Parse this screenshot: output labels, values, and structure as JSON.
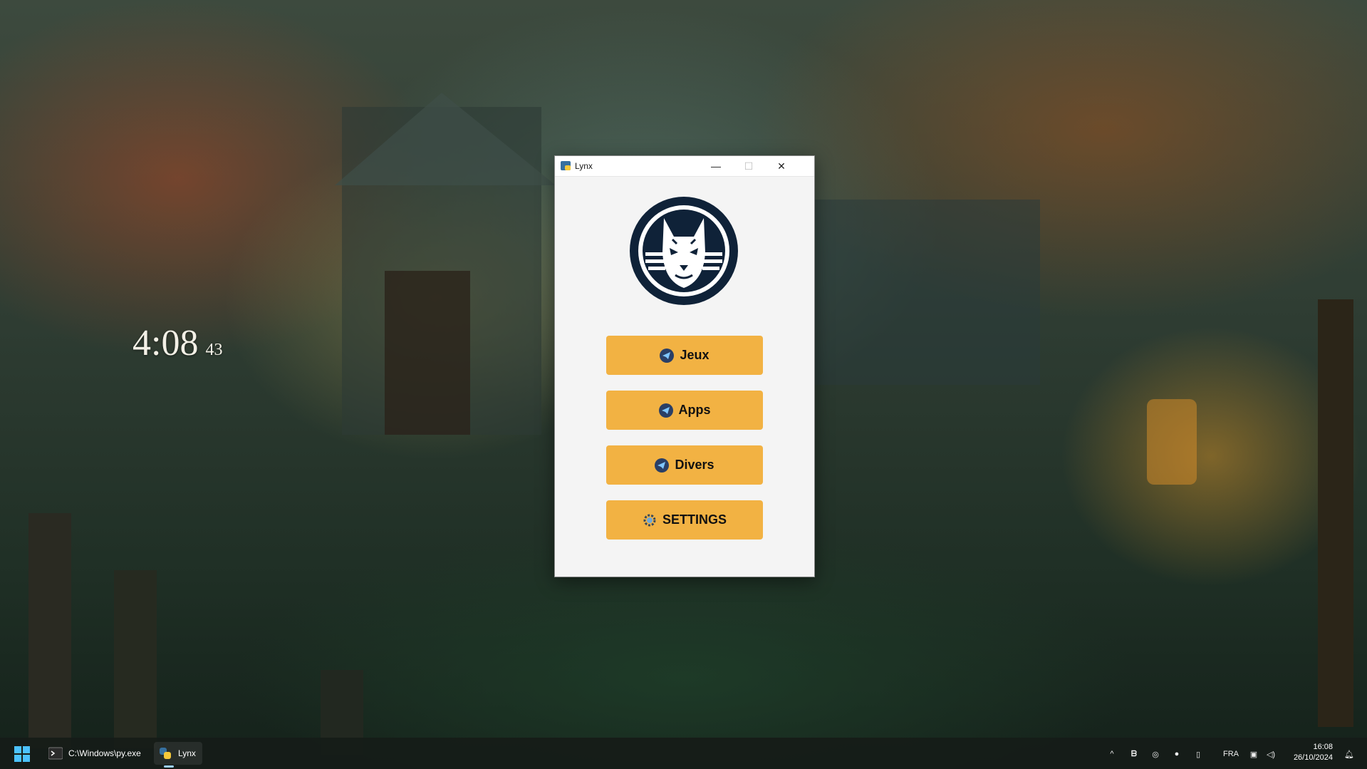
{
  "desktop": {
    "clock": {
      "time": "4:08",
      "seconds": "43"
    }
  },
  "window": {
    "title": "Lynx",
    "controls": {
      "minimize": "—",
      "maximize": "☐",
      "close": "✕"
    },
    "buttons": [
      {
        "label": "Jeux",
        "icon": "telegram-plane-icon"
      },
      {
        "label": "Apps",
        "icon": "telegram-plane-icon"
      },
      {
        "label": "Divers",
        "icon": "telegram-plane-icon"
      },
      {
        "label": "SETTINGS",
        "icon": "gear-icon"
      }
    ],
    "button_color": "#f2b243",
    "logo_color": "#0f2238"
  },
  "taskbar": {
    "items": [
      {
        "label": "C:\\Windows\\py.exe",
        "icon": "terminal-icon"
      },
      {
        "label": "Lynx",
        "icon": "python-icon",
        "active": true
      }
    ],
    "tray": {
      "chevron": "^",
      "language": "FRA",
      "time": "16:08",
      "date": "26/10/2024"
    }
  }
}
